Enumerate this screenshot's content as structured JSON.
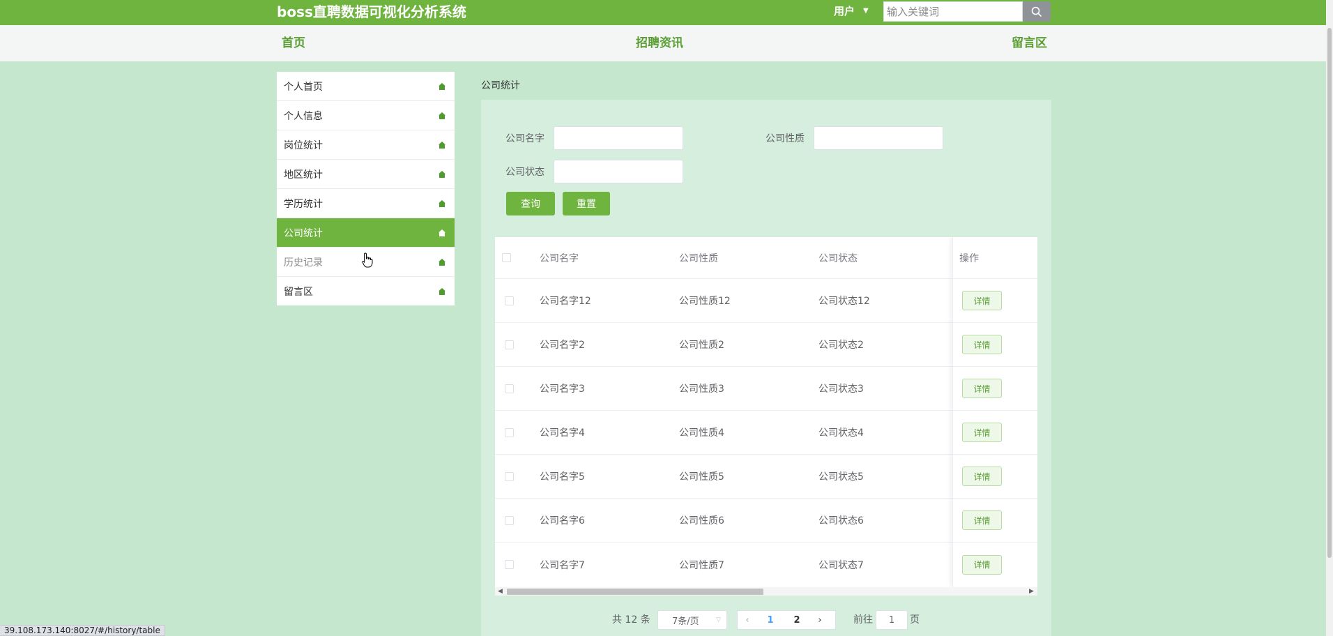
{
  "header": {
    "title": "boss直聘数据可视化分析系统",
    "user_label": "用户",
    "search_placeholder": "输入关键词"
  },
  "nav": {
    "home": "首页",
    "jobs": "招聘资讯",
    "messages": "留言区"
  },
  "sidebar": {
    "items": [
      {
        "label": "个人首页"
      },
      {
        "label": "个人信息"
      },
      {
        "label": "岗位统计"
      },
      {
        "label": "地区统计"
      },
      {
        "label": "学历统计"
      },
      {
        "label": "公司统计",
        "active": true
      },
      {
        "label": "历史记录",
        "hover": true
      },
      {
        "label": "留言区"
      }
    ]
  },
  "breadcrumb": "公司统计",
  "search_form": {
    "company_name_label": "公司名字",
    "company_type_label": "公司性质",
    "company_status_label": "公司状态",
    "query_button": "查询",
    "reset_button": "重置"
  },
  "table": {
    "headers": {
      "name": "公司名字",
      "type": "公司性质",
      "status": "公司状态",
      "action": "操作"
    },
    "detail_label": "详情",
    "rows": [
      {
        "name": "公司名字12",
        "type": "公司性质12",
        "status": "公司状态12"
      },
      {
        "name": "公司名字2",
        "type": "公司性质2",
        "status": "公司状态2"
      },
      {
        "name": "公司名字3",
        "type": "公司性质3",
        "status": "公司状态3"
      },
      {
        "name": "公司名字4",
        "type": "公司性质4",
        "status": "公司状态4"
      },
      {
        "name": "公司名字5",
        "type": "公司性质5",
        "status": "公司状态5"
      },
      {
        "name": "公司名字6",
        "type": "公司性质6",
        "status": "公司状态6"
      },
      {
        "name": "公司名字7",
        "type": "公司性质7",
        "status": "公司状态7"
      }
    ]
  },
  "pagination": {
    "total": "共 12 条",
    "page_size": "7条/页",
    "pages": [
      "1",
      "2"
    ],
    "goto_label": "前往",
    "goto_value": "1",
    "page_suffix": "页"
  },
  "status_url": "39.108.173.140:8027/#/history/table",
  "colors": {
    "primary": "#6fb43f",
    "page_bg": "#c4e7cd",
    "panel_bg": "#d6eedd"
  }
}
